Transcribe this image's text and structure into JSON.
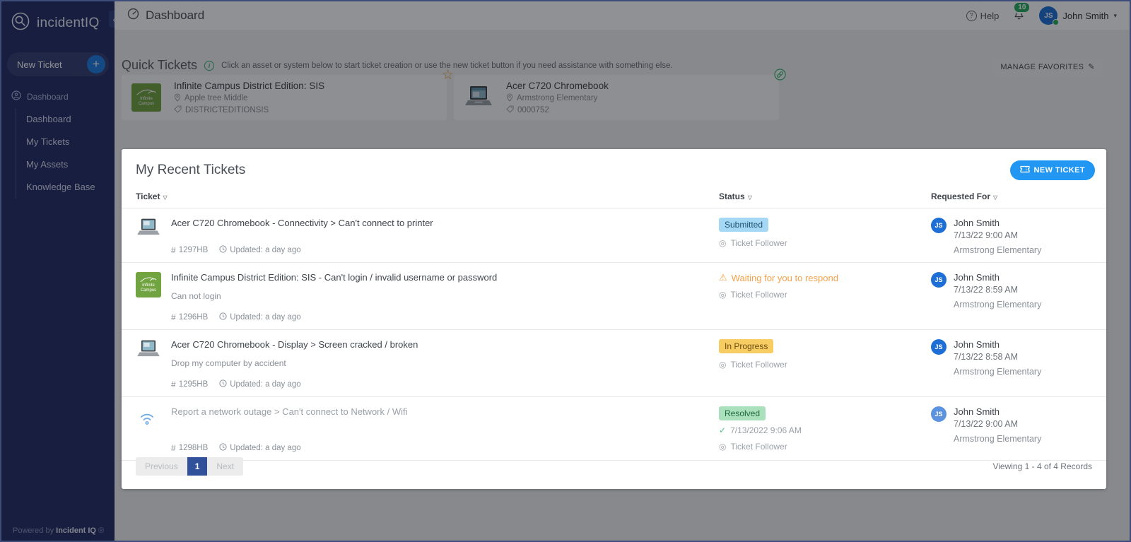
{
  "colors": {
    "sidebar_navy": "#252f66",
    "accent_blue": "#2196f3",
    "plus_blue": "#1f7ce0",
    "notification_green": "#27ae60",
    "warning_orange": "#f5a14b",
    "badge_submitted": "#a5d8f5",
    "badge_in_progress": "#f7cc63",
    "badge_resolved": "#abe0bd",
    "pager_active": "#31519b",
    "infinite_campus_green": "#71a340"
  },
  "icons": {
    "collapse": "‹",
    "plus": "+",
    "sort": "▽",
    "caret_down": "▾",
    "help": "?",
    "info": "i",
    "pencil": "✎",
    "star": "☆",
    "hash": "#",
    "follower": "◎",
    "warning": "⚠",
    "check": "✓"
  },
  "sidebar": {
    "logo_text": "incidentIQ",
    "logo_dot": ".",
    "new_ticket_label": "New Ticket",
    "section_label": "Dashboard",
    "items": [
      {
        "label": "Dashboard"
      },
      {
        "label": "My Tickets"
      },
      {
        "label": "My Assets"
      },
      {
        "label": "Knowledge Base"
      }
    ],
    "footer_prefix": "Powered by",
    "footer_brand": "Incident IQ",
    "footer_registered": "®"
  },
  "header": {
    "title": "Dashboard",
    "help_label": "Help",
    "notification_count": "10",
    "user_initials": "JS",
    "user_name": "John Smith"
  },
  "quick_tickets": {
    "title": "Quick Tickets",
    "hint": "Click an asset or system below to start ticket creation or use the new ticket button if you need assistance with something else.",
    "manage_favorites_label": "MANAGE FAVORITES",
    "cards": [
      {
        "name": "Infinite Campus District Edition: SIS",
        "location": "Apple tree Middle",
        "tag": "DISTRICTEDITIONSIS",
        "corner_icon": "star"
      },
      {
        "name": "Acer C720 Chromebook",
        "location": "Armstrong Elementary",
        "tag": "0000752",
        "corner_icon": "link"
      }
    ]
  },
  "recent_tickets": {
    "title": "My Recent Tickets",
    "new_ticket_label": "NEW TICKET",
    "columns": {
      "ticket": "Ticket",
      "status": "Status",
      "requested_for": "Requested For"
    },
    "rows": [
      {
        "title": "Acer C720 Chromebook - Connectivity > Can't connect to printer",
        "ticket_number": "1297HB",
        "updated": "Updated: a day ago",
        "status": {
          "badge": "Submitted",
          "follower": "Ticket Follower"
        },
        "requested": {
          "initials": "JS",
          "name": "John Smith",
          "date": "7/13/22 9:00 AM",
          "location": "Armstrong Elementary"
        }
      },
      {
        "title": "Infinite Campus District Edition: SIS - Can't login / invalid username or password",
        "subtitle": "Can not login",
        "ticket_number": "1296HB",
        "updated": "Updated: a day ago",
        "status": {
          "warning": "Waiting for you to respond",
          "follower": "Ticket Follower"
        },
        "requested": {
          "initials": "JS",
          "name": "John Smith",
          "date": "7/13/22 8:59 AM",
          "location": "Armstrong Elementary"
        }
      },
      {
        "title": "Acer C720 Chromebook - Display > Screen cracked / broken",
        "subtitle": "Drop my computer by accident",
        "ticket_number": "1295HB",
        "updated": "Updated: a day ago",
        "status": {
          "badge": "In Progress",
          "follower": "Ticket Follower"
        },
        "requested": {
          "initials": "JS",
          "name": "John Smith",
          "date": "7/13/22 8:58 AM",
          "location": "Armstrong Elementary"
        }
      },
      {
        "title": "Report a network outage > Can't connect to Network / Wifi",
        "ticket_number": "1298HB",
        "updated": "Updated: a day ago",
        "status": {
          "badge": "Resolved",
          "resolved_at": "7/13/2022 9:06 AM",
          "follower": "Ticket Follower"
        },
        "requested": {
          "initials": "JS",
          "name": "John Smith",
          "date": "7/13/22 9:00 AM",
          "location": "Armstrong Elementary"
        }
      }
    ],
    "pagination": {
      "previous": "Previous",
      "page": "1",
      "next": "Next"
    },
    "viewing": "Viewing 1 - 4 of 4 Records"
  }
}
